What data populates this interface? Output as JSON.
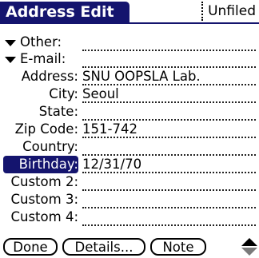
{
  "title": "Address Edit",
  "category": "Unfiled",
  "fields": [
    {
      "label": "Other:",
      "value": ""
    },
    {
      "label": "E-mail:",
      "value": ""
    },
    {
      "label": "Address:",
      "value": "SNU OOPSLA Lab."
    },
    {
      "label": "City:",
      "value": "Seoul"
    },
    {
      "label": "State:",
      "value": ""
    },
    {
      "label": "Zip Code:",
      "value": "151-742"
    },
    {
      "label": "Country:",
      "value": ""
    },
    {
      "label": "Birthday:",
      "value": "12/31/70"
    },
    {
      "label": "Custom 2:",
      "value": ""
    },
    {
      "label": "Custom 3:",
      "value": ""
    },
    {
      "label": "Custom 4:",
      "value": ""
    }
  ],
  "buttons": {
    "done": "Done",
    "details": "Details...",
    "note": "Note"
  },
  "colors": {
    "accent": "#14146e"
  }
}
